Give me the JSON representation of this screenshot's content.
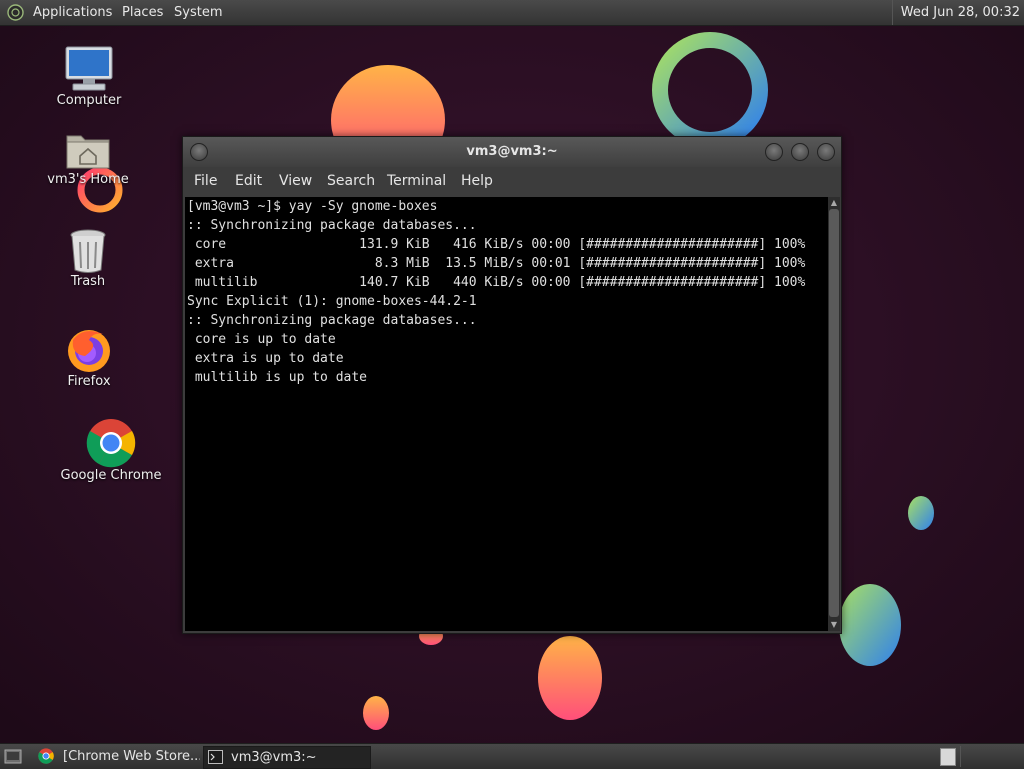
{
  "top_panel": {
    "menus": [
      "Applications",
      "Places",
      "System"
    ],
    "clock": "Wed Jun 28, 00:32"
  },
  "desktop_icons": [
    {
      "label": "Computer",
      "icon": "computer-icon"
    },
    {
      "label": "vm3's Home",
      "icon": "home-folder-icon"
    },
    {
      "label": "Trash",
      "icon": "trash-icon"
    },
    {
      "label": "Firefox",
      "icon": "firefox-icon"
    },
    {
      "label": "Google Chrome",
      "icon": "chrome-icon"
    }
  ],
  "window": {
    "title": "vm3@vm3:~",
    "menu": [
      "File",
      "Edit",
      "View",
      "Search",
      "Terminal",
      "Help"
    ]
  },
  "terminal": {
    "lines": [
      "[vm3@vm3 ~]$ yay -Sy gnome-boxes",
      ":: Synchronizing package databases...",
      " core                 131.9 KiB   416 KiB/s 00:00 [######################] 100%",
      " extra                  8.3 MiB  13.5 MiB/s 00:01 [######################] 100%",
      " multilib             140.7 KiB   440 KiB/s 00:00 [######################] 100%",
      "Sync Explicit (1): gnome-boxes-44.2-1",
      ":: Synchronizing package databases...",
      " core is up to date",
      " extra is up to date",
      " multilib is up to date"
    ]
  },
  "taskbar": {
    "tasks": [
      {
        "label": "[Chrome Web Store...",
        "icon": "chrome-icon"
      },
      {
        "label": "vm3@vm3:~",
        "icon": "terminal-icon"
      }
    ]
  },
  "colors": {
    "panel": "#3a3a3a",
    "terminal_bg": "#000000",
    "terminal_fg": "#e0e0e0",
    "wallpaper": "#2a0f22"
  }
}
